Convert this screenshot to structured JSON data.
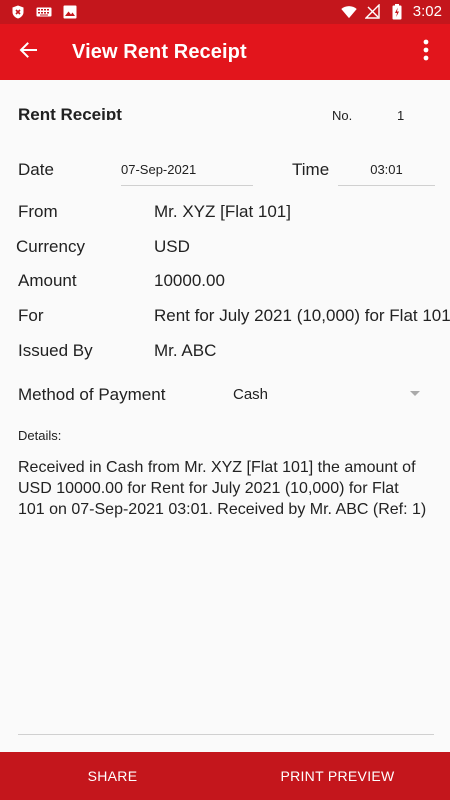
{
  "status_bar": {
    "time": "3:02",
    "icons": [
      "shield-icon",
      "keyboard-icon",
      "image-icon",
      "wifi-icon",
      "no-signal-icon",
      "battery-icon"
    ]
  },
  "app_bar": {
    "title": "View Rent Receipt",
    "back_icon": "arrow-back-icon",
    "menu_icon": "more-vert-icon"
  },
  "colors": {
    "primary": "#e2151c",
    "primary_dark": "#c4161c"
  },
  "receipt": {
    "heading": "Rent Receipt",
    "no_label": "No.",
    "no_value": "1",
    "date_label": "Date",
    "date_value": "07-Sep-2021",
    "time_label": "Time",
    "time_value": "03:01",
    "from_label": "From",
    "from_value": "Mr. XYZ [Flat 101]",
    "currency_label": "Currency",
    "currency_value": "USD",
    "amount_label": "Amount",
    "amount_value": "10000.00",
    "for_label": "For",
    "for_value": "Rent for July 2021 (10,000) for Flat 101",
    "issued_by_label": "Issued By",
    "issued_by_value": "Mr. ABC",
    "method_label": "Method of Payment",
    "method_value": "Cash",
    "details_label": "Details:",
    "details_text": "Received in Cash from Mr. XYZ [Flat 101] the amount of USD 10000.00 for Rent for July 2021 (10,000) for Flat 101 on 07-Sep-2021 03:01. Received by Mr. ABC (Ref: 1)"
  },
  "bottom_bar": {
    "share_label": "SHARE",
    "print_preview_label": "PRINT PREVIEW"
  }
}
